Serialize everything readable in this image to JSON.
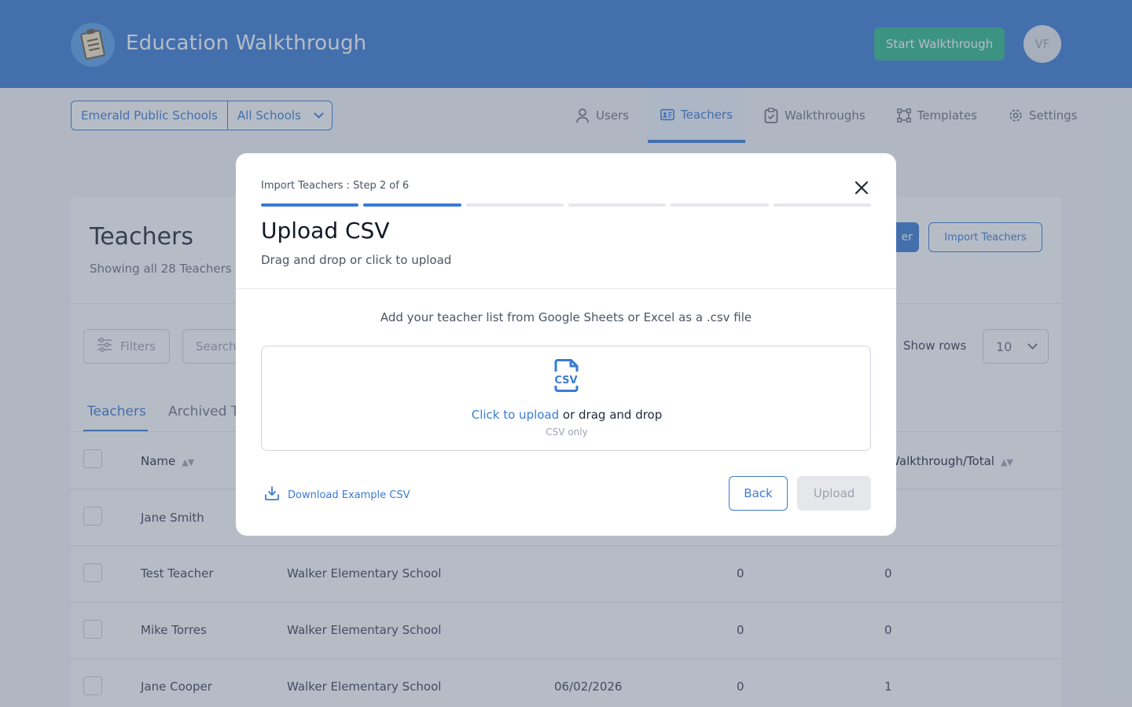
{
  "header": {
    "app_title": "Education Walkthrough",
    "start_button": "Start Walkthrough",
    "avatar_initials": "VF",
    "colors": {
      "header_bg": "#3a7bd5",
      "accent": "#3a7bd5",
      "start_button": "#2fb88a"
    }
  },
  "subnav": {
    "district": "Emerald Public Schools",
    "school": "All Schools",
    "items": [
      {
        "label": "Users",
        "icon": "user-icon"
      },
      {
        "label": "Teachers",
        "icon": "id-card-icon",
        "active": true
      },
      {
        "label": "Walkthroughs",
        "icon": "clipboard-check-icon"
      },
      {
        "label": "Templates",
        "icon": "template-icon"
      },
      {
        "label": "Settings",
        "icon": "gear-icon"
      }
    ]
  },
  "page": {
    "title": "Teachers",
    "subtitle": "Showing all 28 Teachers a",
    "add_button": "er",
    "import_button": "Import Teachers",
    "filters": "Filters",
    "search_placeholder": "Search",
    "show_rows_label": "Show rows",
    "show_rows_value": "10",
    "tabs": [
      "Teachers",
      "Archived T"
    ],
    "columns": {
      "name": "Name",
      "walkthrough_total": "Walkthrough/Total"
    },
    "rows": [
      {
        "name": "Jane Smith",
        "school": "",
        "date": "",
        "count": "",
        "total": ""
      },
      {
        "name": "Test Teacher",
        "school": "Walker Elementary School",
        "date": "",
        "count": "0",
        "total": "0"
      },
      {
        "name": "Mike Torres",
        "school": "Walker Elementary School",
        "date": "",
        "count": "0",
        "total": "0"
      },
      {
        "name": "Jane Cooper",
        "school": "Walker Elementary School",
        "date": "06/02/2026",
        "count": "0",
        "total": "1"
      }
    ]
  },
  "modal": {
    "step_label": "Import Teachers : Step 2 of 6",
    "progress": {
      "current": 2,
      "total": 6
    },
    "title": "Upload CSV",
    "subtitle": "Drag and drop or click to upload",
    "instruction": "Add your teacher list from Google Sheets or Excel as a .csv file",
    "dropzone": {
      "icon": "csv-file-icon",
      "click_text": "Click to upload",
      "rest_text": " or drag and drop",
      "hint": "CSV only"
    },
    "download_link": "Download Example CSV",
    "back_button": "Back",
    "upload_button": "Upload"
  }
}
